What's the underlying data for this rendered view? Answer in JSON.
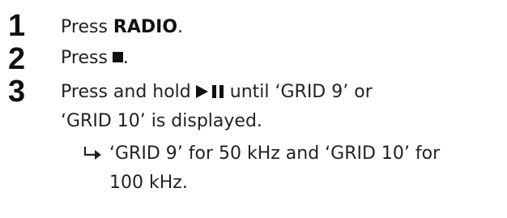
{
  "steps": [
    {
      "number": "1",
      "prefix": "Press ",
      "bold": "RADIO",
      "suffix": "."
    },
    {
      "number": "2",
      "prefix": "Press",
      "icon": "stop-icon",
      "suffix": "."
    },
    {
      "number": "3",
      "prefix": "Press and hold",
      "icon": "play-pause-icon",
      "line1_suffix": "until ‘GRID 9’ or",
      "line2": "‘GRID 10’ is displayed.",
      "result_icon": "result-arrow-icon",
      "result_line1": "‘GRID 9’ for 50 kHz and ‘GRID 10’ for",
      "result_line2": "100 kHz."
    }
  ]
}
